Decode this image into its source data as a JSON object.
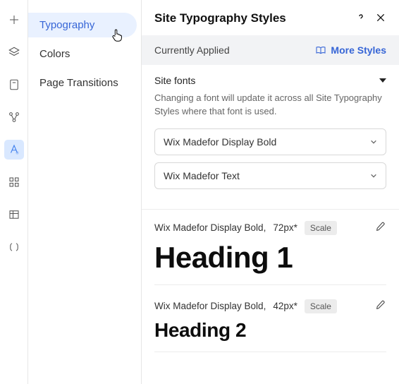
{
  "rail": {
    "icons": [
      {
        "name": "plus-icon"
      },
      {
        "name": "layers-icon"
      },
      {
        "name": "content-icon"
      },
      {
        "name": "structure-icon"
      },
      {
        "name": "text-style-icon",
        "active": true
      },
      {
        "name": "apps-icon"
      },
      {
        "name": "table-icon"
      },
      {
        "name": "code-icon"
      }
    ]
  },
  "sidemenu": {
    "items": [
      {
        "label": "Typography",
        "active": true
      },
      {
        "label": "Colors"
      },
      {
        "label": "Page Transitions"
      }
    ]
  },
  "panel": {
    "title": "Site Typography Styles",
    "applied_label": "Currently Applied",
    "more_label": "More Styles"
  },
  "sitefonts": {
    "title": "Site fonts",
    "hint": "Changing a font will update it across all Site Typography Styles where that font is used.",
    "font1": "Wix Madefor Display Bold",
    "font2": "Wix Madefor Text"
  },
  "styles": [
    {
      "font": "Wix Madefor Display Bold",
      "size": "72px*",
      "chip": "Scale",
      "sample": "Heading 1",
      "kind": "h1"
    },
    {
      "font": "Wix Madefor Display Bold",
      "size": "42px*",
      "chip": "Scale",
      "sample": "Heading 2",
      "kind": "h2"
    }
  ]
}
